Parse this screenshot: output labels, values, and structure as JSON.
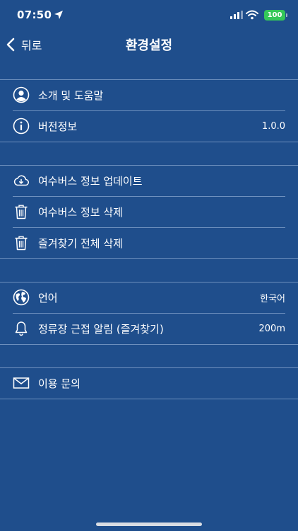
{
  "status_bar": {
    "time": "07:50",
    "battery": "100",
    "battery_color": "#34c759"
  },
  "nav": {
    "back_label": "뒤로",
    "title": "환경설정"
  },
  "sections": [
    {
      "rows": [
        {
          "icon": "person-circle-icon",
          "label": "소개 및 도움말",
          "value": ""
        },
        {
          "icon": "info-circle-icon",
          "label": "버전정보",
          "value": "1.0.0"
        }
      ]
    },
    {
      "rows": [
        {
          "icon": "cloud-download-icon",
          "label": "여수버스 정보 업데이트",
          "value": ""
        },
        {
          "icon": "trash-icon",
          "label": "여수버스 정보 삭제",
          "value": ""
        },
        {
          "icon": "trash-icon",
          "label": "즐겨찾기 전체 삭제",
          "value": ""
        }
      ]
    },
    {
      "rows": [
        {
          "icon": "globe-icon",
          "label": "언어",
          "value": "한국어"
        },
        {
          "icon": "bell-icon",
          "label": "정류장 근접 알림 (즐겨찾기)",
          "value": "200m"
        }
      ]
    },
    {
      "rows": [
        {
          "icon": "envelope-icon",
          "label": "이용 문의",
          "value": ""
        }
      ]
    }
  ],
  "colors": {
    "background": "#1f4e8c",
    "separator": "#8aa7cf",
    "text": "#ffffff"
  }
}
